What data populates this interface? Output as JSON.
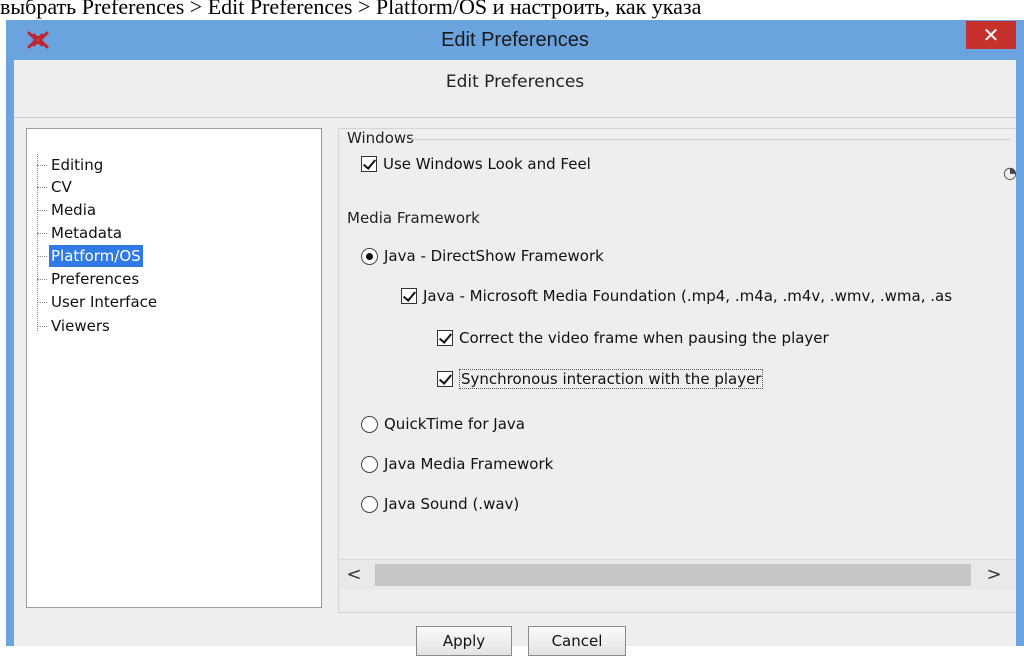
{
  "doc_text": "выбрать Preferences > Edit Preferences > Platform/OS и настроить, как указа",
  "window": {
    "title": "Edit Preferences",
    "close_label": "✕"
  },
  "header": {
    "title": "Edit Preferences"
  },
  "tree": {
    "items": [
      {
        "label": "Editing",
        "selected": false
      },
      {
        "label": "CV",
        "selected": false
      },
      {
        "label": "Media",
        "selected": false
      },
      {
        "label": "Metadata",
        "selected": false
      },
      {
        "label": "Platform/OS",
        "selected": true
      },
      {
        "label": "Preferences",
        "selected": false
      },
      {
        "label": "User Interface",
        "selected": false
      },
      {
        "label": "Viewers",
        "selected": false
      }
    ]
  },
  "windows_section": {
    "label": "Windows",
    "look_and_feel": {
      "label": "Use Windows Look and Feel",
      "checked": true
    }
  },
  "media_section": {
    "label": "Media Framework",
    "directshow": {
      "label": "Java - DirectShow Framework",
      "selected": true
    },
    "mmf": {
      "label": "Java - Microsoft Media Foundation (.mp4, .m4a, .m4v, .wmv, .wma, .as",
      "checked": true
    },
    "correct_frame": {
      "label": "Correct the video frame when pausing the player",
      "checked": true
    },
    "sync_interaction": {
      "label": "Synchronous interaction with the player",
      "checked": true
    },
    "quicktime": {
      "label": "QuickTime for Java",
      "selected": false
    },
    "jmf": {
      "label": "Java Media Framework",
      "selected": false
    },
    "java_sound": {
      "label": "Java Sound (.wav)",
      "selected": false
    }
  },
  "scrollbar": {
    "left_arrow": "<",
    "right_arrow": ">"
  },
  "buttons": {
    "apply": "Apply",
    "cancel": "Cancel"
  },
  "icons": {
    "app": "elan-logo-icon",
    "close": "close-icon"
  },
  "colors": {
    "titlebar": "#6aa3de",
    "close": "#c7312b",
    "selection": "#2f7ae4"
  }
}
